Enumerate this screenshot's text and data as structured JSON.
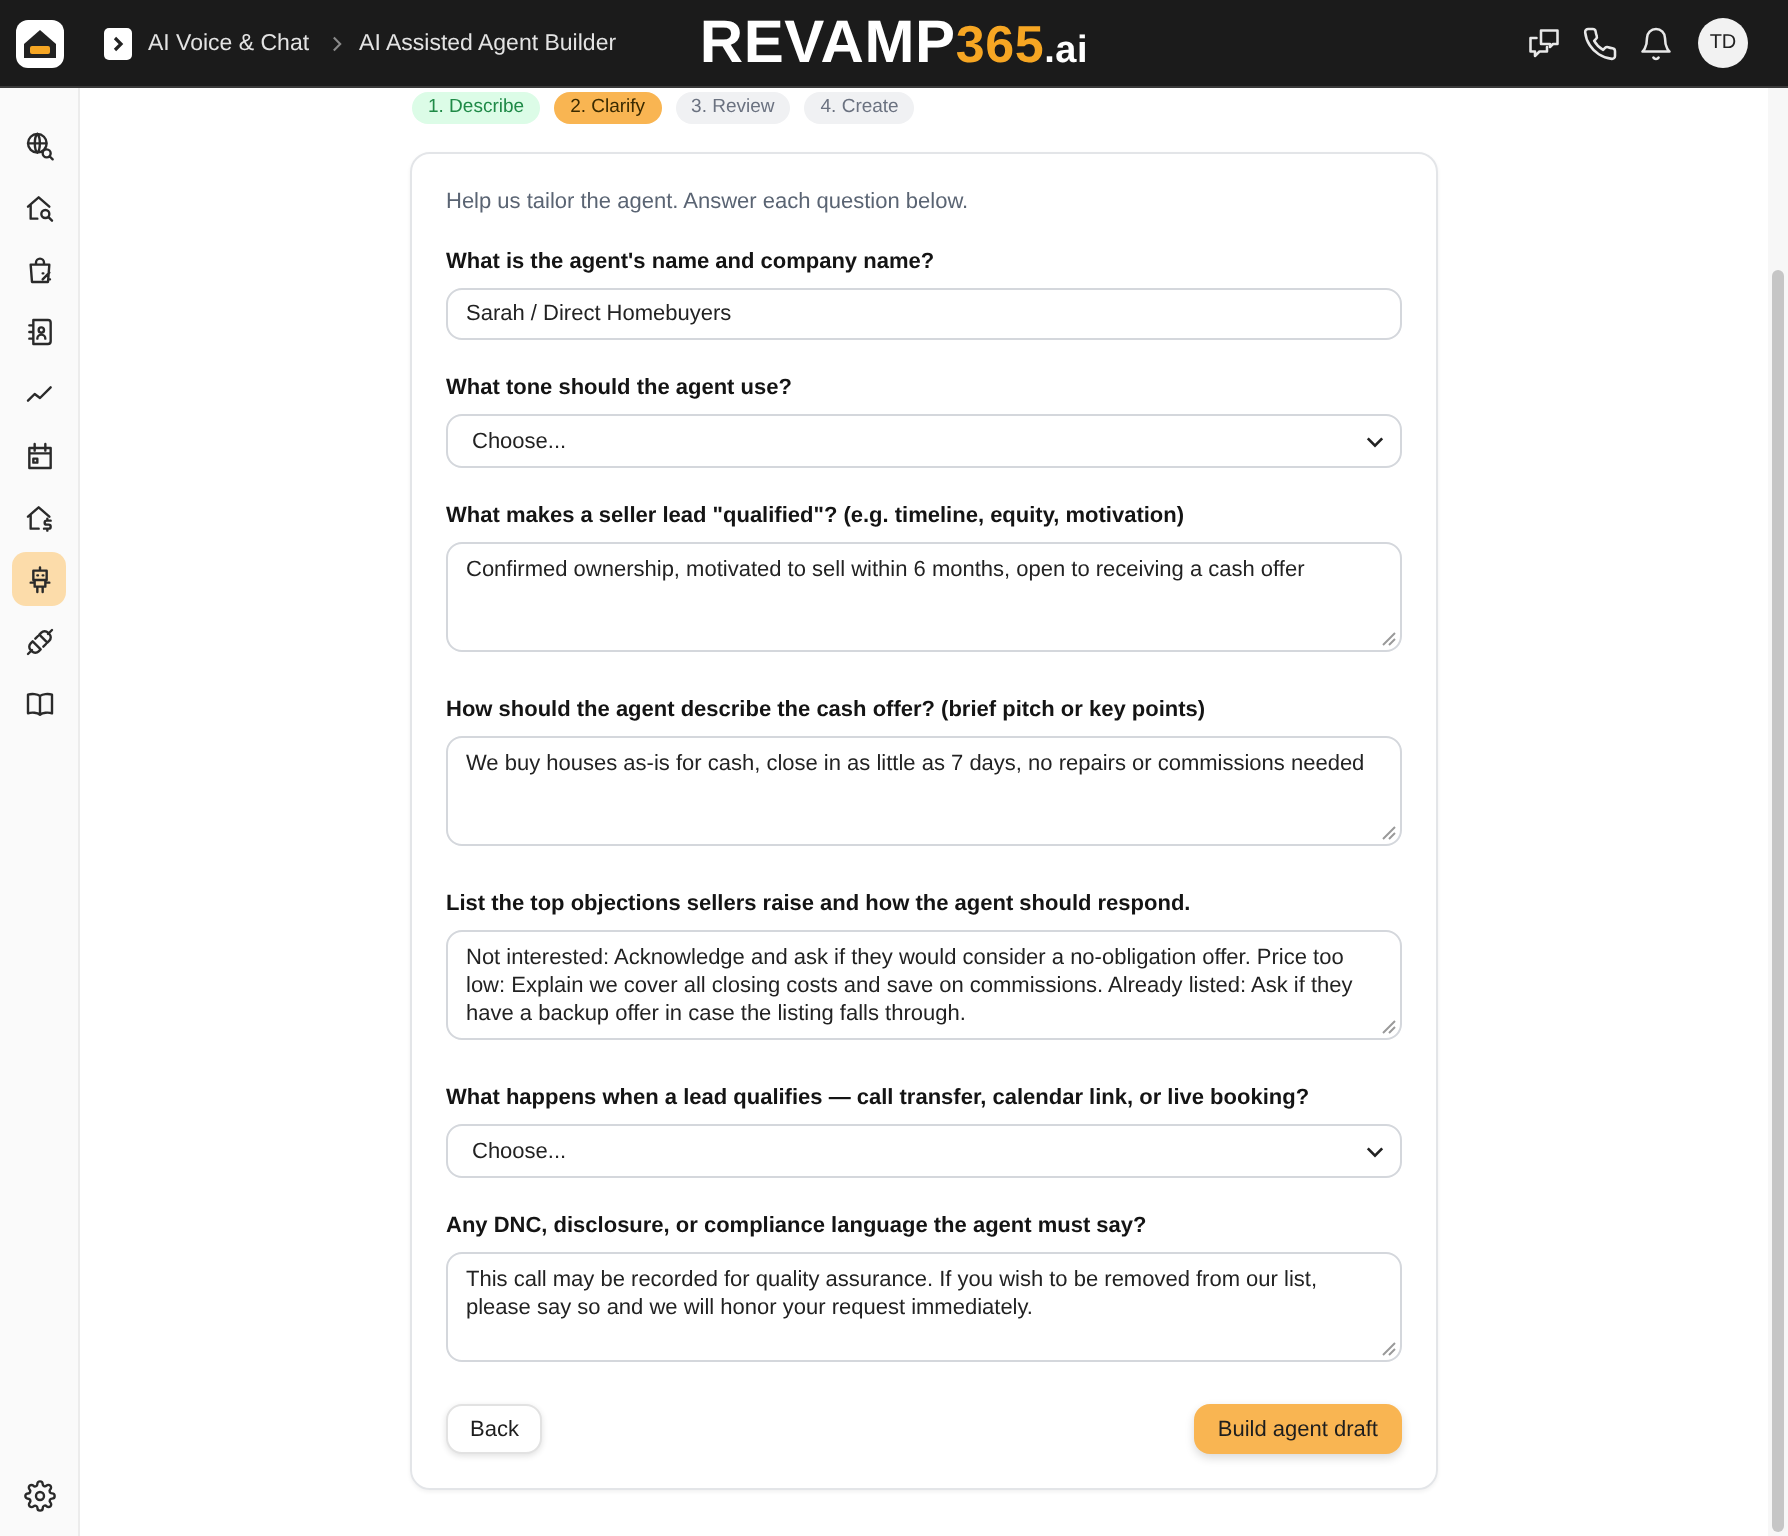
{
  "header": {
    "breadcrumb": [
      "AI Voice & Chat",
      "AI Assisted Agent Builder"
    ],
    "brand": {
      "name": "REVAMP",
      "number": "365",
      "suffix": ".ai"
    },
    "avatar": {
      "initials": "TD"
    }
  },
  "sidebar": {
    "items": [
      {
        "selected": false
      },
      {
        "selected": false
      },
      {
        "selected": false
      },
      {
        "selected": false
      },
      {
        "selected": false
      },
      {
        "selected": false
      },
      {
        "selected": false
      },
      {
        "selected": true
      },
      {
        "selected": false
      },
      {
        "selected": false
      }
    ]
  },
  "steps": [
    {
      "label": "1. Describe",
      "completed": true,
      "selected": false
    },
    {
      "label": "2. Clarify",
      "completed": false,
      "selected": true
    },
    {
      "label": "3. Review",
      "completed": false,
      "selected": false
    },
    {
      "label": "4. Create",
      "completed": false,
      "selected": false
    }
  ],
  "form": {
    "intro": "Help us tailor the agent. Answer each question below.",
    "questions": [
      {
        "label": "What is the agent's name and company name?",
        "kind": "text",
        "value": "Sarah / Direct Homebuyers"
      },
      {
        "label": "What tone should the agent use?",
        "kind": "select",
        "value": "Choose..."
      },
      {
        "label": "What makes a seller lead \"qualified\"? (e.g. timeline, equity, motivation)",
        "kind": "textarea",
        "value": "Confirmed ownership, motivated to sell within 6 months, open to receiving a cash offer"
      },
      {
        "label": "How should the agent describe the cash offer? (brief pitch or key points)",
        "kind": "textarea",
        "value": "We buy houses as-is for cash, close in as little as 7 days, no repairs or commissions needed"
      },
      {
        "label": "List the top objections sellers raise and how the agent should respond.",
        "kind": "textarea",
        "value": "Not interested: Acknowledge and ask if they would consider a no-obligation offer. Price too low: Explain we cover all closing costs and save on commissions. Already listed: Ask if they have a backup offer in case the listing falls through."
      },
      {
        "label": "What happens when a lead qualifies — call transfer, calendar link, or live booking?",
        "kind": "select",
        "value": "Choose..."
      },
      {
        "label": "Any DNC, disclosure, or compliance language the agent must say?",
        "kind": "textarea",
        "value": "This call may be recorded for quality assurance. If you wish to be removed from our list, please say so and we will honor your request immediately."
      }
    ],
    "buttons": [
      {
        "label": "Back",
        "kind": "secondary"
      },
      {
        "label": "Build agent draft",
        "kind": "primary"
      }
    ]
  }
}
